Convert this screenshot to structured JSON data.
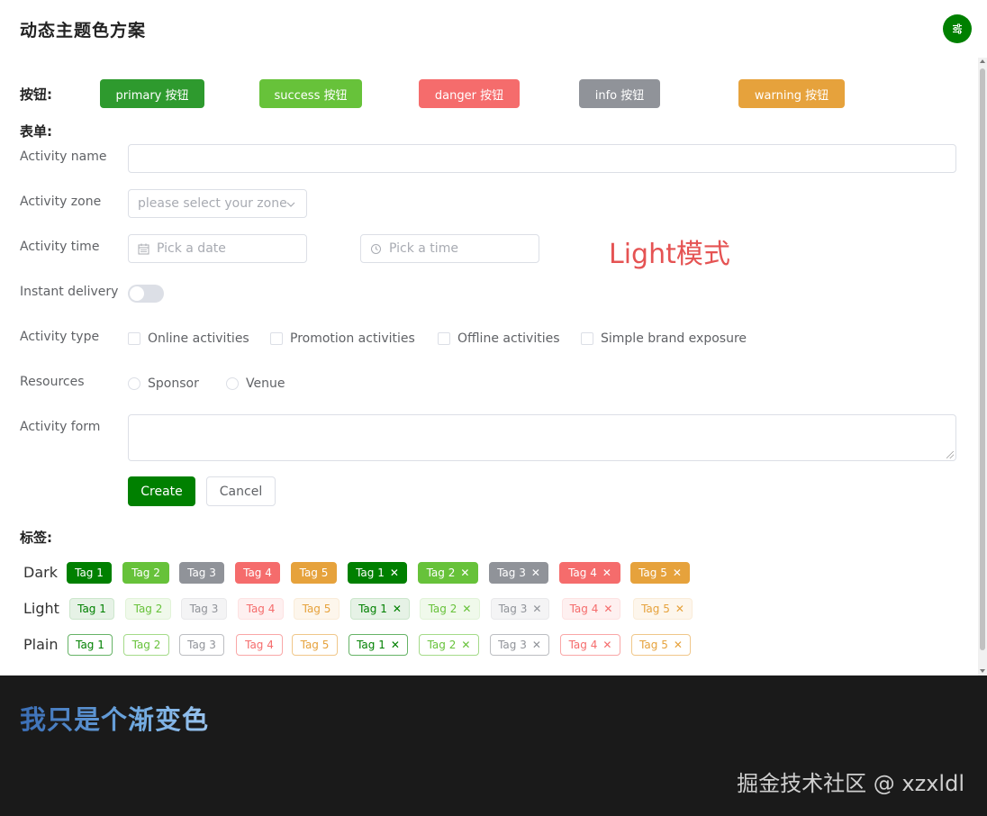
{
  "header": {
    "title": "动态主题色方案",
    "theme_button_icon": "sliders-icon"
  },
  "buttons_section": {
    "label": "按钮:",
    "buttons": [
      {
        "label": "primary 按钮",
        "color": "#2e9a2e"
      },
      {
        "label": "success 按钮",
        "color": "#67c23a"
      },
      {
        "label": "danger 按钮",
        "color": "#f56c6c"
      },
      {
        "label": "info 按钮",
        "color": "#909399"
      },
      {
        "label": "warning 按钮",
        "color": "#e6a23c"
      }
    ]
  },
  "form": {
    "section_label": "表单:",
    "activity_name_label": "Activity name",
    "activity_name_value": "",
    "activity_zone_label": "Activity zone",
    "activity_zone_placeholder": "please select your zone",
    "activity_time_label": "Activity time",
    "date_placeholder": "Pick a date",
    "time_placeholder": "Pick a time",
    "instant_delivery_label": "Instant delivery",
    "instant_delivery_on": false,
    "activity_type_label": "Activity type",
    "activity_types": [
      "Online activities",
      "Promotion activities",
      "Offline activities",
      "Simple brand exposure"
    ],
    "resources_label": "Resources",
    "resources": [
      "Sponsor",
      "Venue"
    ],
    "activity_form_label": "Activity form",
    "activity_form_value": "",
    "create_label": "Create",
    "cancel_label": "Cancel"
  },
  "mode_text": "Light模式",
  "tags_section": {
    "label": "标签:",
    "rows": [
      {
        "name": "Dark",
        "tags": [
          "Tag 1",
          "Tag 2",
          "Tag 3",
          "Tag 4",
          "Tag 5",
          "Tag 1",
          "Tag 2",
          "Tag 3",
          "Tag 4",
          "Tag 5"
        ]
      },
      {
        "name": "Light",
        "tags": [
          "Tag 1",
          "Tag 2",
          "Tag 3",
          "Tag 4",
          "Tag 5",
          "Tag 1",
          "Tag 2",
          "Tag 3",
          "Tag 4",
          "Tag 5"
        ]
      },
      {
        "name": "Plain",
        "tags": [
          "Tag 1",
          "Tag 2",
          "Tag 3",
          "Tag 4",
          "Tag 5",
          "Tag 1",
          "Tag 2",
          "Tag 3",
          "Tag 4",
          "Tag 5"
        ]
      }
    ],
    "colors": {
      "primary": "#008000",
      "success": "#67c23a",
      "info": "#909399",
      "danger": "#f56c6c",
      "warning": "#e6a23c"
    }
  },
  "footer": {
    "gradient_text": "我只是个渐变色",
    "watermark": "掘金技术社区 @ xzxldl"
  }
}
